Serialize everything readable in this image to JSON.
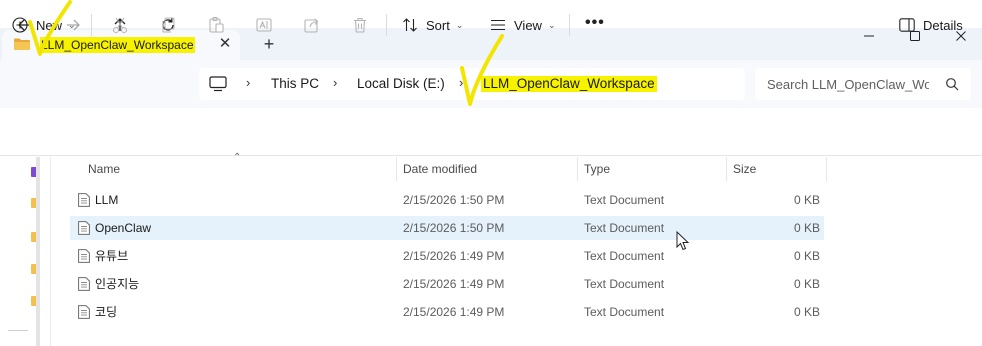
{
  "window": {
    "tab_title": "LLM_OpenClaw_Workspace",
    "tab_close_glyph": "✕",
    "new_tab_glyph": "+",
    "minimize_glyph": "—",
    "maximize_glyph": "☐",
    "close_glyph": "✕"
  },
  "address": {
    "crumbs": [
      "This PC",
      "Local Disk (E:)",
      "LLM_OpenClaw_Workspace"
    ],
    "separator": "›",
    "search_placeholder": "Search LLM_OpenClaw_Workspace"
  },
  "toolbar": {
    "new_label": "New",
    "sort_label": "Sort",
    "view_label": "View",
    "more_glyph": "•••",
    "details_label": "Details",
    "caret_glyph": "⌄"
  },
  "columns": {
    "name": "Name",
    "date": "Date modified",
    "type": "Type",
    "size": "Size"
  },
  "files": [
    {
      "name": "LLM",
      "date": "2/15/2026 1:50 PM",
      "type": "Text Document",
      "size": "0 KB",
      "selected": false
    },
    {
      "name": "OpenClaw",
      "date": "2/15/2026 1:50 PM",
      "type": "Text Document",
      "size": "0 KB",
      "selected": true
    },
    {
      "name": "유튜브",
      "date": "2/15/2026 1:49 PM",
      "type": "Text Document",
      "size": "0 KB",
      "selected": false
    },
    {
      "name": "인공지능",
      "date": "2/15/2026 1:49 PM",
      "type": "Text Document",
      "size": "0 KB",
      "selected": false
    },
    {
      "name": "코딩",
      "date": "2/15/2026 1:49 PM",
      "type": "Text Document",
      "size": "0 KB",
      "selected": false
    }
  ],
  "colors": {
    "highlight": "#f6f200",
    "selection": "#e5f1fb",
    "folder": "#f2c14e",
    "annotation": "#f2e600"
  }
}
